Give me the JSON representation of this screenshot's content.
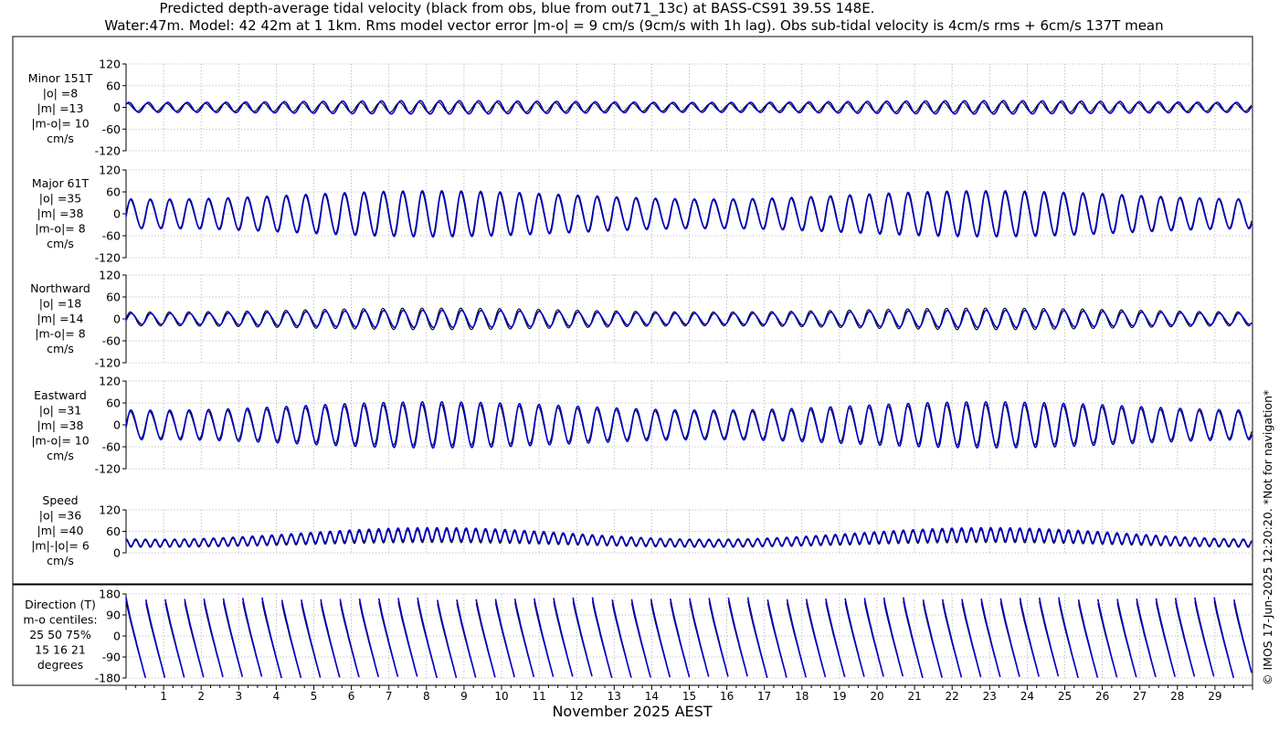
{
  "header": {
    "title_line1": "Predicted depth-average tidal velocity (black from obs, blue from out71_13c) at BASS-CS91 39.5S 148E.",
    "title_line2": "Water:47m. Model: 42 42m at 1 1km. Rms model vector error |m-o| = 9 cm/s (9cm/s with 1h lag). Obs sub-tidal velocity is 4cm/s rms + 6cm/s 137T mean"
  },
  "footer": {
    "xlabel": "November 2025 AEST",
    "copyright": "© IMOS 17-Jun-2025 12:20:20. *Not for navigation*"
  },
  "colors": {
    "obs": "#000000",
    "model": "#0000cc",
    "grid": "#9a9a9a",
    "axis": "#000000",
    "background": "#ffffff"
  },
  "chart_data": {
    "type": "line",
    "x_axis": {
      "label": "November 2025 AEST",
      "range_days": [
        0,
        30
      ],
      "tick_labels": [
        "1",
        "2",
        "3",
        "4",
        "5",
        "6",
        "7",
        "8",
        "9",
        "10",
        "11",
        "12",
        "13",
        "14",
        "15",
        "16",
        "17",
        "18",
        "19",
        "20",
        "21",
        "22",
        "23",
        "24",
        "25",
        "26",
        "27",
        "28",
        "29"
      ],
      "minor_ticks_per_day": 4,
      "grid": true
    },
    "series_legend": [
      "obs",
      "out71_13c"
    ],
    "tidal_period_hours": 12.42,
    "panels": [
      {
        "id": "minor",
        "label_lines": [
          "Minor 151T",
          "|o| =8",
          "|m| =13",
          "|m-o|= 10",
          "cm/s"
        ],
        "ylim": [
          -120,
          120
        ],
        "yticks": [
          -120,
          -60,
          0,
          60,
          120
        ],
        "yticklabels": [
          "-120",
          "-60",
          "0",
          "60",
          "120"
        ],
        "obs_amplitude": 12,
        "model_amplitude": 16,
        "phase_offset_hours": 0.9,
        "spring_neap_modulation": 0.15
      },
      {
        "id": "major",
        "label_lines": [
          "Major 61T",
          "|o| =35",
          "|m| =38",
          "|m-o|= 8",
          "cm/s"
        ],
        "ylim": [
          -120,
          120
        ],
        "yticks": [
          -120,
          -60,
          0,
          60,
          120
        ],
        "yticklabels": [
          "-120",
          "-60",
          "0",
          "60",
          "120"
        ],
        "obs_amplitude": 48,
        "model_amplitude": 51,
        "phase_offset_hours": 0.3,
        "spring_neap_modulation": 0.22
      },
      {
        "id": "northward",
        "label_lines": [
          "Northward",
          "|o| =18",
          "|m| =14",
          "|m-o|= 8",
          "cm/s"
        ],
        "ylim": [
          -120,
          120
        ],
        "yticks": [
          -120,
          -60,
          0,
          60,
          120
        ],
        "yticklabels": [
          "-120",
          "-60",
          "0",
          "60",
          "120"
        ],
        "obs_amplitude": 24,
        "model_amplitude": 19,
        "phase_offset_hours": 0.5,
        "spring_neap_modulation": 0.22
      },
      {
        "id": "eastward",
        "label_lines": [
          "Eastward",
          "|o| =31",
          "|m| =38",
          "|m-o|= 10",
          "cm/s"
        ],
        "ylim": [
          -120,
          120
        ],
        "yticks": [
          -120,
          -60,
          0,
          60,
          120
        ],
        "yticklabels": [
          "-120",
          "-60",
          "0",
          "60",
          "120"
        ],
        "obs_amplitude": 45,
        "model_amplitude": 51,
        "phase_offset_hours": 0.3,
        "spring_neap_modulation": 0.22
      },
      {
        "id": "speed",
        "label_lines": [
          "Speed",
          "|o| =36",
          "|m| =40",
          "|m|-|o|= 6",
          "cm/s"
        ],
        "ylim": [
          0,
          120
        ],
        "yticks": [
          0,
          60,
          120
        ],
        "yticklabels": [
          "0",
          "60",
          "120"
        ],
        "obs_mean": 36,
        "model_mean": 40,
        "semidiurnal_swing": 14,
        "spring_neap_modulation": 0.3
      },
      {
        "id": "direction",
        "label_lines": [
          "Direction (T)",
          "m-o centiles:",
          "25  50  75%",
          "15  16  21",
          "degrees"
        ],
        "ylim": [
          -180,
          180
        ],
        "yticks": [
          -180,
          -90,
          0,
          90,
          180
        ],
        "yticklabels": [
          "-180",
          "-90",
          "0",
          "90",
          "180"
        ],
        "m_o_centiles": {
          "p25": 15,
          "p50": 16,
          "p75": 21
        }
      }
    ]
  }
}
